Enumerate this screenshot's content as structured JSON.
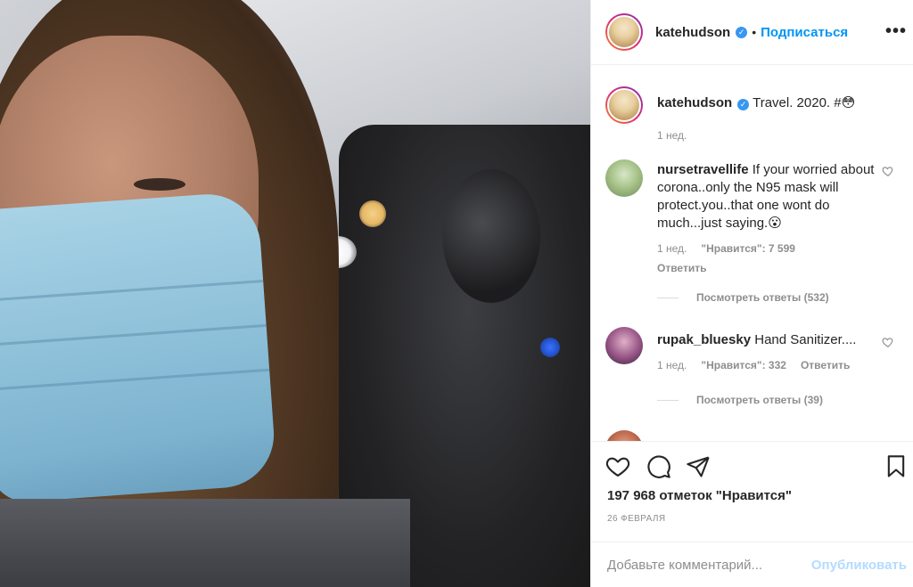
{
  "post": {
    "username": "katehudson",
    "follow_label": "Подписаться",
    "dot": "•",
    "more_label": "•••",
    "caption_text": "Travel. 2020. #😳",
    "caption_time": "1 нед.",
    "likes_text": "197 968 отметок \"Нравится\"",
    "date": "26 февраля"
  },
  "comments": [
    {
      "username": "nursetravellife",
      "text": "If your worried about corona..only the N95 mask will protect.you..that one wont do much...just saying.😮",
      "time": "1 нед.",
      "likes": "\"Нравится\": 7 599",
      "reply": "Ответить",
      "view_replies": "Посмотреть ответы (532)"
    },
    {
      "username": "rupak_bluesky",
      "text": "Hand Sanitizer....",
      "time": "1 нед.",
      "likes": "\"Нравится\": 332",
      "reply": "Ответить",
      "view_replies": "Посмотреть ответы (39)"
    }
  ],
  "add_comment": {
    "placeholder": "Добавьте комментарий...",
    "post_label": "Опубликовать"
  },
  "icons": {
    "like": "heart-icon",
    "comment": "comment-icon",
    "share": "share-icon",
    "save": "bookmark-icon",
    "verified": "verified-badge-icon"
  },
  "colors": {
    "follow": "#0095f6",
    "verified": "#3897f0",
    "muted_text": "#8e8e8e",
    "post_disabled": "#b3dbff"
  }
}
